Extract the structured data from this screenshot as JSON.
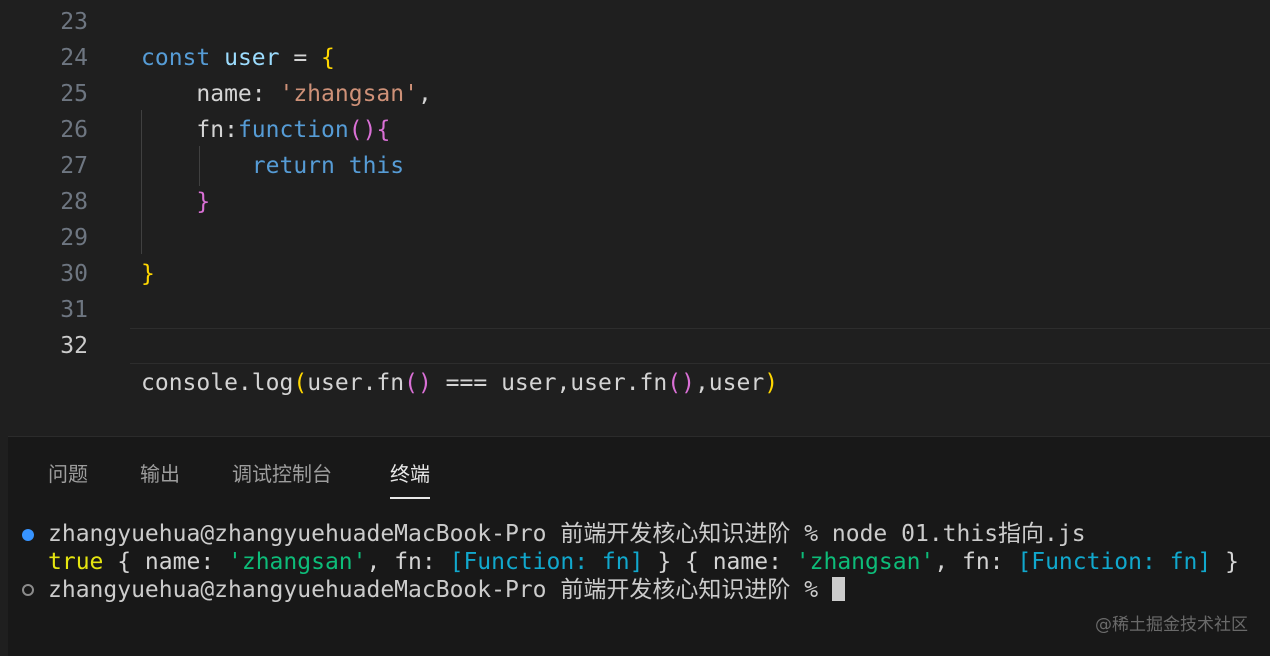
{
  "editor": {
    "lines": [
      {
        "num": "23",
        "tokens": []
      },
      {
        "num": "24",
        "tokens": [
          {
            "t": "const",
            "c": "kw"
          },
          {
            "t": " ",
            "c": "plain"
          },
          {
            "t": "user",
            "c": "var"
          },
          {
            "t": " = ",
            "c": "plain"
          },
          {
            "t": "{",
            "c": "br1"
          }
        ]
      },
      {
        "num": "25",
        "tokens": [
          {
            "t": "    name",
            "c": "prop"
          },
          {
            "t": ": ",
            "c": "plain"
          },
          {
            "t": "'zhangsan'",
            "c": "str"
          },
          {
            "t": ",",
            "c": "plain"
          }
        ]
      },
      {
        "num": "26",
        "tokens": [
          {
            "t": "    fn",
            "c": "prop"
          },
          {
            "t": ":",
            "c": "plain"
          },
          {
            "t": "function",
            "c": "kw"
          },
          {
            "t": "()",
            "c": "br2"
          },
          {
            "t": "{",
            "c": "br2"
          }
        ]
      },
      {
        "num": "27",
        "tokens": [
          {
            "t": "        return",
            "c": "kw"
          },
          {
            "t": " ",
            "c": "plain"
          },
          {
            "t": "this",
            "c": "kw"
          }
        ]
      },
      {
        "num": "28",
        "tokens": [
          {
            "t": "    }",
            "c": "br2"
          }
        ]
      },
      {
        "num": "29",
        "tokens": []
      },
      {
        "num": "30",
        "tokens": [
          {
            "t": "}",
            "c": "br1"
          }
        ]
      },
      {
        "num": "31",
        "tokens": []
      }
    ],
    "current_line": {
      "num": "32",
      "tokens": [
        {
          "t": "console.log",
          "c": "plain"
        },
        {
          "t": "(",
          "c": "br1"
        },
        {
          "t": "user.fn",
          "c": "plain"
        },
        {
          "t": "()",
          "c": "br2"
        },
        {
          "t": " === user,user.fn",
          "c": "plain"
        },
        {
          "t": "()",
          "c": "br2"
        },
        {
          "t": ",user",
          "c": "plain"
        },
        {
          "t": ")",
          "c": "br1"
        }
      ]
    }
  },
  "panel": {
    "tabs": [
      "问题",
      "输出",
      "调试控制台",
      "终端"
    ],
    "active_tab": "终端"
  },
  "terminal": {
    "line1": "zhangyuehua@zhangyuehuadeMacBook-Pro 前端开发核心知识进阶 % node 01.this指向.js",
    "line2_tokens": [
      {
        "t": "true",
        "c": "t-yellow"
      },
      {
        "t": " { name: ",
        "c": "plain"
      },
      {
        "t": "'zhangsan'",
        "c": "t-green"
      },
      {
        "t": ", fn: ",
        "c": "plain"
      },
      {
        "t": "[Function: fn]",
        "c": "t-cyan"
      },
      {
        "t": " } { name: ",
        "c": "plain"
      },
      {
        "t": "'zhangsan'",
        "c": "t-green"
      },
      {
        "t": ", fn: ",
        "c": "plain"
      },
      {
        "t": "[Function: fn]",
        "c": "t-cyan"
      },
      {
        "t": " }",
        "c": "plain"
      }
    ],
    "line3": "zhangyuehua@zhangyuehuadeMacBook-Pro 前端开发核心知识进阶 % "
  },
  "watermark": "@稀土掘金技术社区"
}
